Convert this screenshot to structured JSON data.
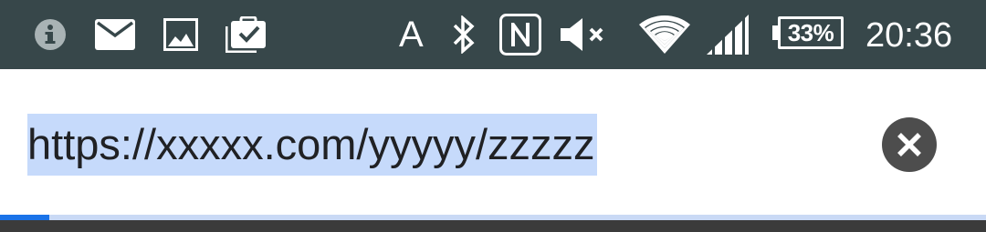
{
  "status_bar": {
    "notification_icons": [
      "info-icon",
      "mail-icon",
      "image-icon",
      "clipboard-check-icon"
    ],
    "status_icons": [
      "auto-brightness-icon",
      "bluetooth-icon",
      "nfc-icon",
      "volume-muted-icon",
      "wifi-icon",
      "cellular-signal-icon"
    ],
    "auto_letter": "A",
    "battery": {
      "label": "33%",
      "level_percent": 33
    },
    "time": "20:36",
    "background_color": "#37474a"
  },
  "url_bar": {
    "url": "https://xxxxx.com/yyyyy/zzzzz",
    "selection_color": "#c6dafb",
    "clear_icon": "close-icon"
  },
  "page_load_progress": {
    "percent": 5,
    "fill_color": "#1a73e8",
    "track_color": "#c9d9f5"
  }
}
